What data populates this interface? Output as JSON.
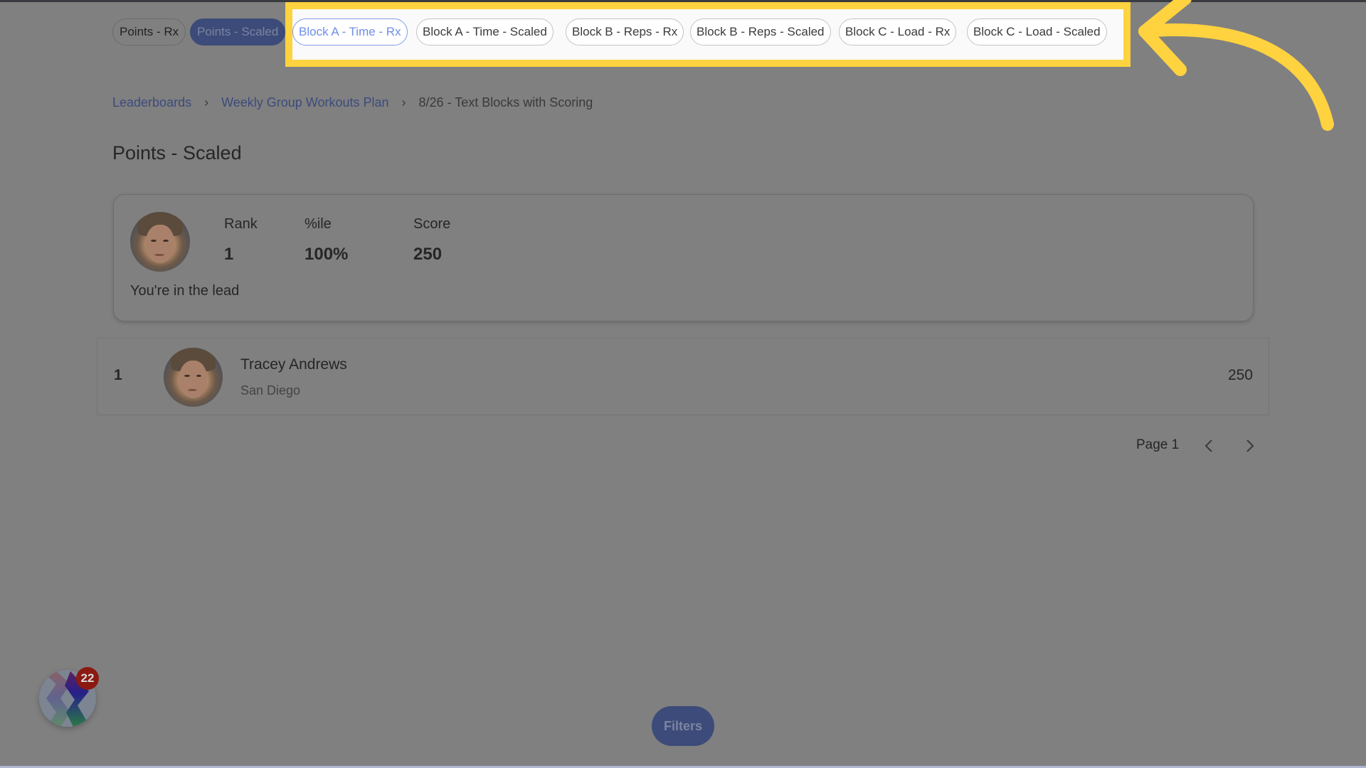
{
  "tabs": {
    "dimmed": [
      {
        "label": "Points - Rx",
        "active": false
      },
      {
        "label": "Points - Scaled",
        "active": true
      }
    ],
    "highlighted": [
      {
        "label": "Block A - Time - Rx",
        "selected": true
      },
      {
        "label": "Block A - Time - Scaled",
        "selected": false
      },
      {
        "label": "Block B - Reps - Rx",
        "selected": false
      },
      {
        "label": "Block B - Reps - Scaled",
        "selected": false
      },
      {
        "label": "Block C - Load - Rx",
        "selected": false
      },
      {
        "label": "Block C - Load - Scaled",
        "selected": false
      }
    ]
  },
  "breadcrumb": {
    "items": [
      {
        "label": "Leaderboards"
      },
      {
        "label": "Weekly Group Workouts Plan"
      }
    ],
    "current": "8/26 - Text Blocks with Scoring"
  },
  "page_title": "Points - Scaled",
  "summary_card": {
    "rank_label": "Rank",
    "rank_value": "1",
    "percentile_label": "%ile",
    "percentile_value": "100%",
    "score_label": "Score",
    "score_value": "250",
    "status_text": "You're in the lead"
  },
  "leaderboard": {
    "rows": [
      {
        "rank": "1",
        "name": "Tracey Andrews",
        "location": "San Diego",
        "score": "250"
      }
    ]
  },
  "pagination": {
    "label": "Page 1",
    "prev_icon": "chevron-left-icon",
    "next_icon": "chevron-right-icon"
  },
  "filters_button": "Filters",
  "launcher": {
    "badge_count": "22",
    "icon": "app-launcher-icon"
  },
  "annotation": {
    "highlight_color": "#ffd23f",
    "arrow_icon": "curved-arrow-icon"
  },
  "colors": {
    "overlay": "#808080",
    "primary": "#3c4b79",
    "selected_tab": "#6e8ee8",
    "badge": "#8a1a12"
  }
}
